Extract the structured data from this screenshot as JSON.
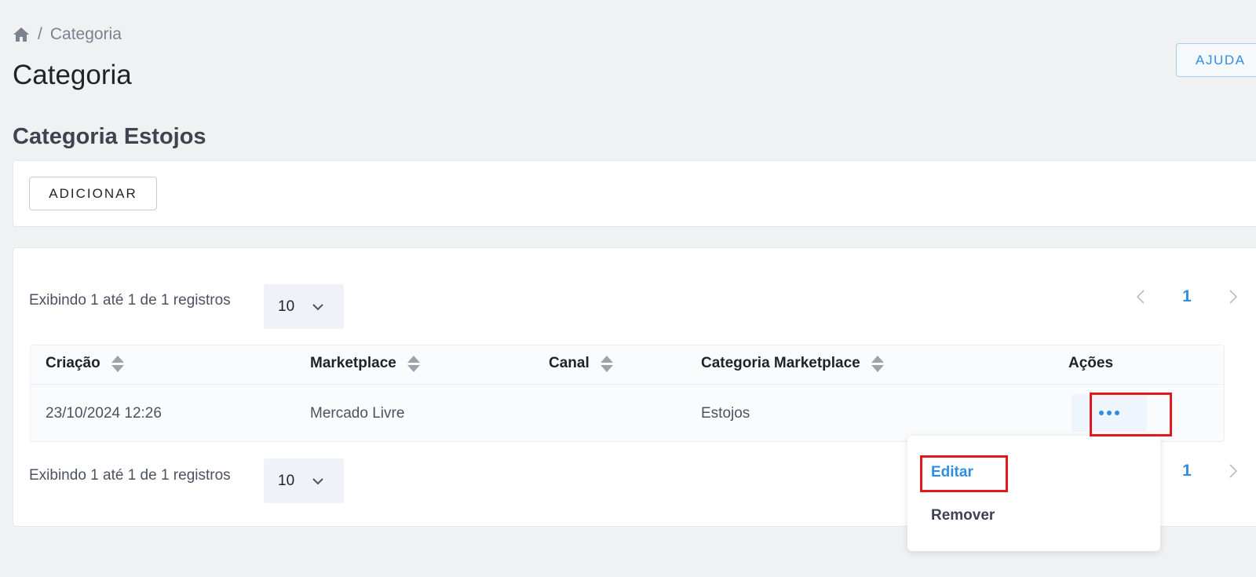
{
  "breadcrumb": {
    "home_icon": "home-icon",
    "separator": "/",
    "current": "Categoria"
  },
  "page": {
    "title": "Categoria",
    "help_label": "AJUDA"
  },
  "section": {
    "title": "Categoria Estojos",
    "add_label": "ADICIONAR"
  },
  "listing": {
    "records_text": "Exibindo 1 até 1 de 1 registros",
    "page_size": "10",
    "current_page": "1"
  },
  "table": {
    "columns": [
      "Criação",
      "Marketplace",
      "Canal",
      "Categoria Marketplace",
      "Ações"
    ],
    "rows": [
      {
        "criacao": "23/10/2024 12:26",
        "marketplace": "Mercado Livre",
        "canal": "",
        "categoria_marketplace": "Estojos"
      }
    ]
  },
  "actions_menu": {
    "edit_label": "Editar",
    "remove_label": "Remover"
  },
  "colors": {
    "accent": "#2f8ee3",
    "highlight": "#e01a1a",
    "background": "#f0f1f3"
  }
}
